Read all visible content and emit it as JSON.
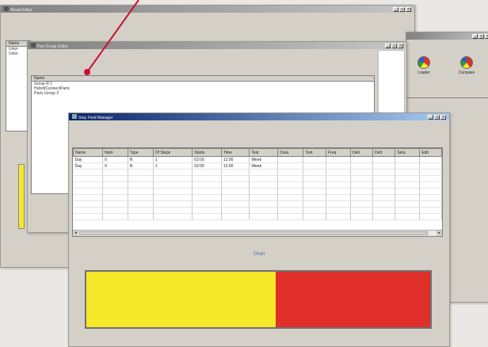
{
  "back_window": {
    "title": "Modul Editor",
    "side_list": {
      "header": "Name",
      "items": [
        "Unkn",
        "Unkn"
      ]
    }
  },
  "right_window": {
    "toolbar": [
      {
        "label": "Loader",
        "icon": "pie-chart-icon"
      },
      {
        "label": "Compare",
        "icon": "pie-chart-icon"
      }
    ]
  },
  "group_window": {
    "title": "Part Group Editor",
    "column_header": "Name",
    "items": [
      "Group R 1",
      "HybridConnectParts",
      "Parts Group 2"
    ]
  },
  "front_window": {
    "title": "Step Field Manager",
    "columns": [
      "Name",
      "Num",
      "Type",
      "Of Steps",
      "Starts",
      "Time",
      "Test",
      "Dura",
      "Test",
      "Freq",
      "Delt",
      "Delt",
      "Setu",
      "Edit"
    ],
    "rows": [
      [
        "Day",
        "0",
        "N",
        "1",
        "02:00",
        "12:00",
        "Week",
        "",
        "",
        "",
        "",
        "",
        "",
        ""
      ],
      [
        "Day",
        "0",
        "N",
        "1",
        "02:00",
        "12:00",
        "Week",
        "",
        "",
        "",
        "",
        "",
        "",
        ""
      ]
    ],
    "chart_caption": "Chart",
    "progress": {
      "fill_fraction": 0.55,
      "fill_color": "#f5e829",
      "rest_color": "#e02f2a"
    }
  },
  "colors": {
    "pointer_line": "#c8102e",
    "left_bar": "#f5e829"
  }
}
